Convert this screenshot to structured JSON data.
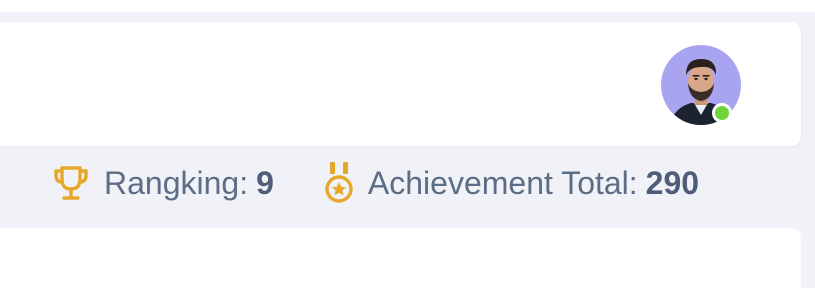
{
  "profile": {
    "avatar_icon": "user-avatar",
    "status": "online",
    "status_color": "#6fd43a",
    "avatar_bg_color": "#a9a4ef"
  },
  "stats": {
    "ranking": {
      "icon": "trophy-icon",
      "label": "Rangking:",
      "value": "9"
    },
    "achievement": {
      "icon": "medal-icon",
      "label": "Achievement Total:",
      "value": "290"
    }
  },
  "colors": {
    "icon_gold": "#e6a82a",
    "text": "#5d6d86",
    "background": "#f1f2f7",
    "card": "#ffffff"
  }
}
